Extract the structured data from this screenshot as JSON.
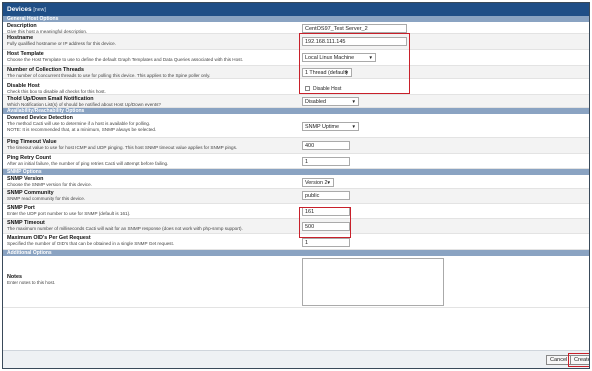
{
  "header": {
    "title": "Devices",
    "subtitle": "[new]"
  },
  "sections": {
    "general": "General Host Options",
    "availability": "Availability/Reachability Options",
    "snmp": "SNMP Options",
    "additional": "Additional Options"
  },
  "fields": {
    "description": {
      "label": "Description",
      "help": "Give this host a meaningful description.",
      "value": "CentOS97_Test Server_2"
    },
    "hostname": {
      "label": "Hostname",
      "help": "Fully qualified hostname or IP address for this device.",
      "value": "192.168.111.145"
    },
    "host_template": {
      "label": "Host Template",
      "help": "Choose the Host Template to use to define the default Graph Templates and Data Queries associated with this Host.",
      "value": "Local Linux Machine"
    },
    "threads": {
      "label": "Number of Collection Threads",
      "help": "The number of concurrent threads to use for polling this device. This applies to the Spine poller only.",
      "value": "1 Thread (default)"
    },
    "disable_host": {
      "label": "Disable Host",
      "help": "Check this box to disable all checks for this host.",
      "checkbox_label": "Disable Host"
    },
    "thold": {
      "label": "Thold Up/Down Email Notification",
      "help": "Which Notification List(s) of should be notified about Host Up/Down events?",
      "value": "Disabled"
    },
    "downed": {
      "label": "Downed Device Detection",
      "help1": "The method Cacti will use to determine if a host is available for polling.",
      "help2": "NOTE: It is recommended that, at a minimum, SNMP always be selected.",
      "value": "SNMP Uptime"
    },
    "ping_timeout": {
      "label": "Ping Timeout Value",
      "help": "The timeout value to use for host ICMP and UDP pinging. This host SNMP timeout value applies for SNMP pings.",
      "value": "400"
    },
    "ping_retry": {
      "label": "Ping Retry Count",
      "help": "After an initial failure, the number of ping retries Cacti will attempt before failing.",
      "value": "1"
    },
    "snmp_version": {
      "label": "SNMP Version",
      "help": "Choose the SNMP version for this device.",
      "value": "Version 2"
    },
    "snmp_community": {
      "label": "SNMP Community",
      "help": "SNMP read community for this device.",
      "value": "public"
    },
    "snmp_port": {
      "label": "SNMP Port",
      "help": "Enter the UDP port number to use for SNMP (default is 161).",
      "value": "161"
    },
    "snmp_timeout": {
      "label": "SNMP Timeout",
      "help": "The maximum number of milliseconds Cacti will wait for an SNMP response (does not work with php-snmp support).",
      "value": "500"
    },
    "max_oids": {
      "label": "Maximum OID's Per Get Request",
      "help": "Specified the number of OID's that can be obtained in a single SNMP Get request.",
      "value": "1"
    },
    "notes": {
      "label": "Notes",
      "help": "Enter notes to this host.",
      "value": ""
    }
  },
  "buttons": {
    "cancel": "Cancel",
    "create": "Create"
  },
  "icons": {
    "dropdown": "chevron-down-icon"
  },
  "colors": {
    "header": "#1f4e86",
    "section": "#8aa3c2",
    "highlight": "#c8202a"
  }
}
